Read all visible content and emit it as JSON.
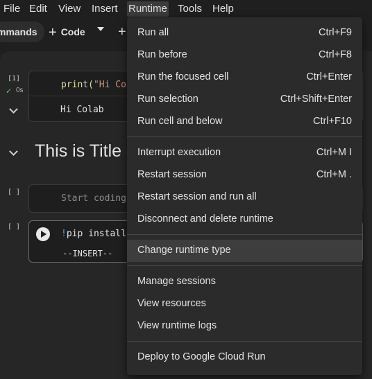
{
  "menubar": {
    "items": [
      "File",
      "Edit",
      "View",
      "Insert",
      "Runtime",
      "Tools",
      "Help"
    ]
  },
  "toolbar": {
    "commands_label": "mmands",
    "code_label": "Code",
    "plus_glyph": "+"
  },
  "cells": {
    "cell1": {
      "count": "[1]",
      "duration": "0s",
      "code_fn": "print(",
      "code_str": "\"Hi Co",
      "output": "Hi Colab"
    },
    "heading": "This is Title",
    "cell2": {
      "count": "[ ]",
      "placeholder": "Start coding"
    },
    "cell3": {
      "count": "[ ]",
      "code_bang": "!",
      "code_rest": "pip install",
      "mode": "--INSERT--"
    }
  },
  "runtime_menu": {
    "groups": [
      [
        {
          "label": "Run all",
          "shortcut": "Ctrl+F9"
        },
        {
          "label": "Run before",
          "shortcut": "Ctrl+F8"
        },
        {
          "label": "Run the focused cell",
          "shortcut": "Ctrl+Enter"
        },
        {
          "label": "Run selection",
          "shortcut": "Ctrl+Shift+Enter"
        },
        {
          "label": "Run cell and below",
          "shortcut": "Ctrl+F10"
        }
      ],
      [
        {
          "label": "Interrupt execution",
          "shortcut": "Ctrl+M I"
        },
        {
          "label": "Restart session",
          "shortcut": "Ctrl+M ."
        },
        {
          "label": "Restart session and run all",
          "shortcut": ""
        },
        {
          "label": "Disconnect and delete runtime",
          "shortcut": ""
        }
      ],
      [
        {
          "label": "Change runtime type",
          "shortcut": "",
          "highlighted": true
        }
      ],
      [
        {
          "label": "Manage sessions",
          "shortcut": ""
        },
        {
          "label": "View resources",
          "shortcut": ""
        },
        {
          "label": "View runtime logs",
          "shortcut": ""
        }
      ],
      [
        {
          "label": "Deploy to Google Cloud Run",
          "shortcut": ""
        }
      ]
    ]
  },
  "colors": {
    "background": "#1f1f1f",
    "menu_bg": "#2b2b2b",
    "highlight": "#3d3d3d",
    "string_orange": "#ce9178",
    "function_yellow": "#dcdcaa",
    "keyword_blue": "#569cd6"
  }
}
